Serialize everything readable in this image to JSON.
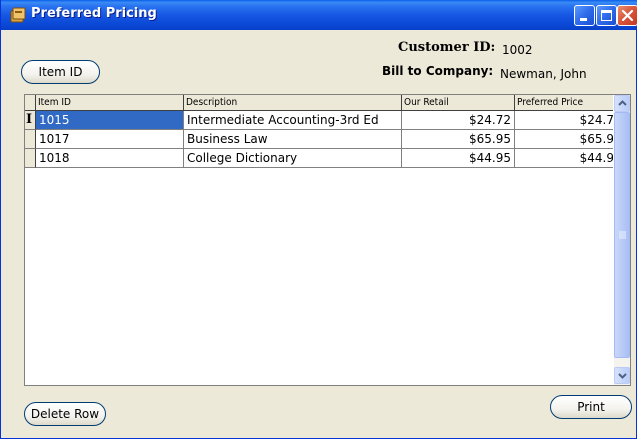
{
  "window": {
    "title": "Preferred Pricing"
  },
  "header": {
    "customer_id_label": "Customer ID:",
    "customer_id_value": "1002",
    "bill_to_label": "Bill to Company:",
    "bill_to_value": "Newman, John"
  },
  "buttons": {
    "item_id": "Item ID",
    "delete_row": "Delete Row",
    "print": "Print"
  },
  "grid": {
    "columns": [
      "Item ID",
      "Description",
      "Our Retail",
      "Preferred Price"
    ],
    "rows": [
      {
        "item_id": "1015",
        "description": "Intermediate Accounting-3rd Ed",
        "our_retail": "$24.72",
        "preferred_price": "$24.7"
      },
      {
        "item_id": "1017",
        "description": "Business Law",
        "our_retail": "$65.95",
        "preferred_price": "$65.9"
      },
      {
        "item_id": "1018",
        "description": "College Dictionary",
        "our_retail": "$44.95",
        "preferred_price": "$44.9"
      }
    ],
    "current_row_marker": "I",
    "selected_row": 0
  },
  "icons": {
    "app": "app-icon",
    "minimize": "minimize-icon",
    "maximize": "maximize-icon",
    "close": "close-icon",
    "scroll_up": "chevron-up-icon",
    "scroll_down": "chevron-down-icon"
  },
  "colors": {
    "titlebar": "#0A49D6",
    "selection": "#316AC5",
    "window_bg": "#ECE9D8"
  }
}
